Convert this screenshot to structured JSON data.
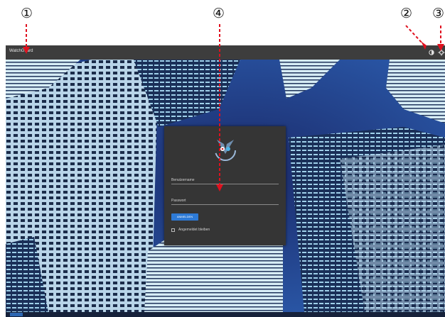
{
  "callouts": [
    "①",
    "④",
    "②",
    "③"
  ],
  "topbar": {
    "title": "WatchGuard",
    "icons": [
      "theme-toggle-icon",
      "settings-icon"
    ]
  },
  "login": {
    "username_label": "Benutzername",
    "password_label": "Passwort",
    "login_button": "ANMELDEN",
    "remember_label": "Angemeldet bleiben"
  },
  "colors": {
    "topbar": "#3d3d3d",
    "card": "#353535",
    "accent": "#2d7ad6",
    "callout_arrow": "#e0101e",
    "sky": "#1e3e86"
  }
}
